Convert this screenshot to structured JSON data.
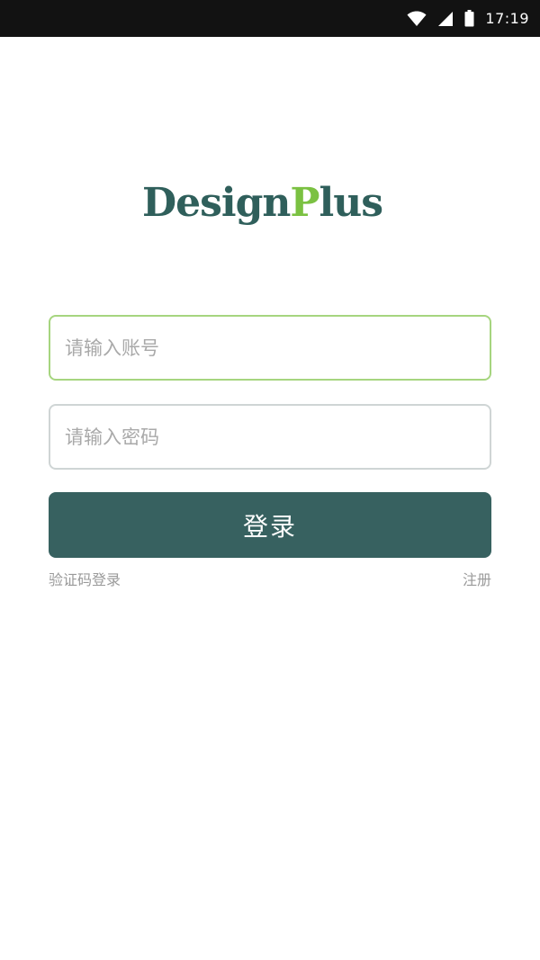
{
  "status_bar": {
    "time": "17:19",
    "icons": [
      "wifi-icon",
      "cellular-signal-icon",
      "battery-icon"
    ],
    "background": "#121212"
  },
  "logo": {
    "text": "DesignPlus",
    "primary_color": "#2f5f5b",
    "accent_color": "#7bc142"
  },
  "form": {
    "account": {
      "placeholder": "请输入账号",
      "value": ""
    },
    "password": {
      "placeholder": "请输入密码",
      "value": ""
    },
    "login_label": "登录",
    "login_color": "#376160"
  },
  "links": {
    "sms_login": "验证码登录",
    "register": "注册"
  }
}
